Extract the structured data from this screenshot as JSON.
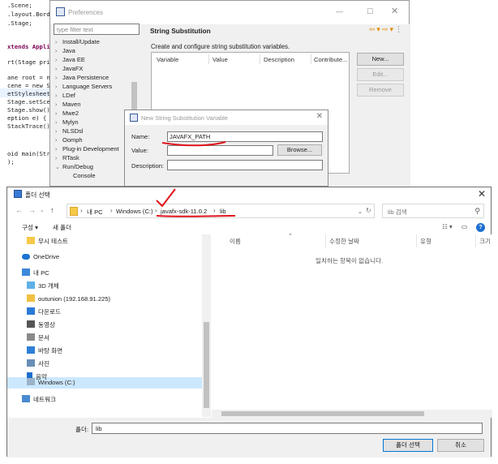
{
  "code_editor": {
    "lines": [
      ".Scene;",
      ".layout.Bord",
      ".Stage;",
      "xtends Appli",
      "rt(Stage pri",
      "ane root = n",
      "cene = new S",
      "etStylesheet",
      "Stage.setSce",
      "Stage.show()",
      "eption e) {",
      "StackTrace()",
      "oid main(Str",
      ");"
    ]
  },
  "preferences": {
    "title": "Preferences",
    "filter_placeholder": "type filter text",
    "tree_items": [
      "Install/Update",
      "Java",
      "Java EE",
      "JavaFX",
      "Java Persistence",
      "Language Servers",
      "LDef",
      "Maven",
      "Mwe2",
      "Mylyn",
      "NLSDsl",
      "Oomph",
      "Plug-in Development",
      "RTask",
      "Run/Debug",
      "Console"
    ],
    "page_title": "String Substitution",
    "description": "Create and configure string substitution variables.",
    "columns": [
      "Value",
      "Description",
      "Contribute..."
    ],
    "first_column": "Variable",
    "buttons": {
      "new": "New...",
      "edit": "Edit...",
      "remove": "Remove"
    }
  },
  "new_variable": {
    "title": "New String Substitution Variable",
    "name_label": "Name:",
    "name_value": "JAVAFX_PATH",
    "value_label": "Value:",
    "value_value": "",
    "browse": "Browse...",
    "description_label": "Description:",
    "description_value": ""
  },
  "folder_picker": {
    "title": "폴더 선택",
    "path": [
      "내 PC",
      "Windows (C:)",
      "javafx-sdk-11.0.2",
      "lib"
    ],
    "search_placeholder": "lib 검색",
    "organize": "구성",
    "new_folder": "새 폴더",
    "nav_items": [
      "무시 테스트",
      "OneDrive",
      "내 PC",
      "3D 개체",
      "outunion (192.168.91.225)",
      "다운로드",
      "동영상",
      "문서",
      "바탕 화면",
      "사진",
      "음악",
      "Windows (C:)",
      "네트워크"
    ],
    "columns": [
      "이름",
      "수정한 날짜",
      "유형",
      "크기"
    ],
    "empty_text": "일치하는 항목이 없습니다.",
    "folder_label": "폴더:",
    "folder_value": "lib",
    "ok": "폴더 선택",
    "cancel": "취소"
  },
  "colors": {
    "accent": "#0078d7",
    "annotation": "#e0141b",
    "eclipse_nav": "#e08a00"
  }
}
